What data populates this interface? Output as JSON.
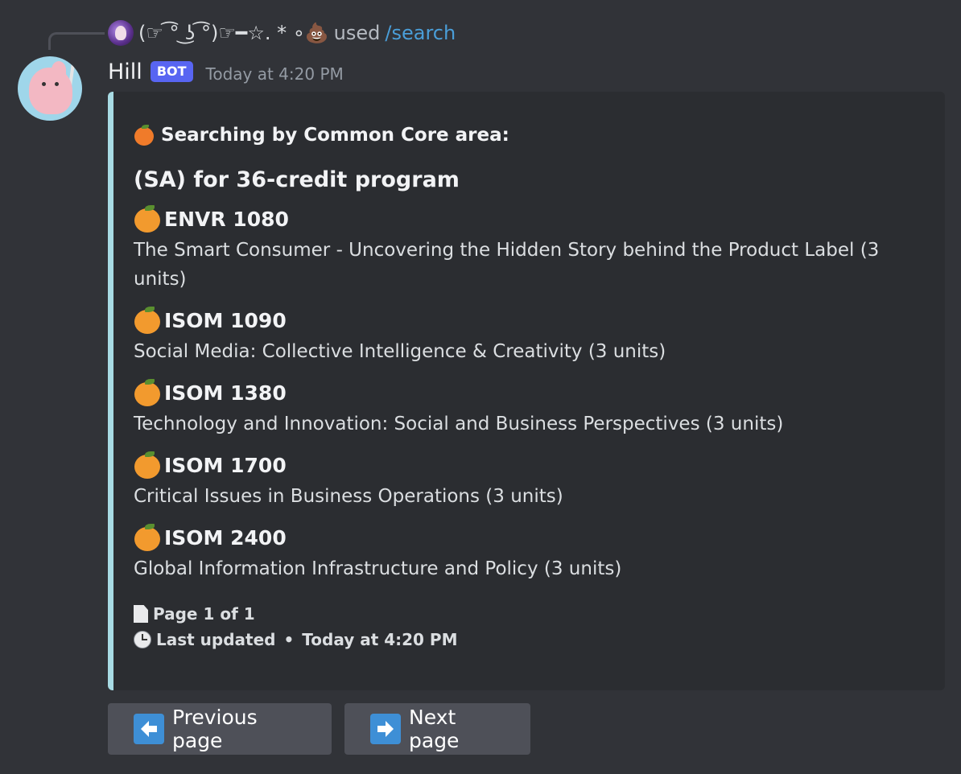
{
  "reply": {
    "user": "(☞ ͡° ͜ʖ ͡°)☞━☆. * ∘💩",
    "used_label": "used",
    "command": "/search"
  },
  "message": {
    "author": "Hill",
    "badge": "BOT",
    "timestamp": "Today at 4:20 PM"
  },
  "embed": {
    "author": "Searching by Common Core area:",
    "title": "(SA) for 36-credit program",
    "accent_color": "#a8dbe4",
    "courses": [
      {
        "code": "ENVR 1080",
        "description": "The Smart Consumer - Uncovering the Hidden Story behind the Product Label (3 units)"
      },
      {
        "code": "ISOM 1090",
        "description": "Social Media: Collective Intelligence & Creativity (3 units)"
      },
      {
        "code": "ISOM 1380",
        "description": "Technology and Innovation: Social and Business Perspectives (3 units)"
      },
      {
        "code": "ISOM 1700",
        "description": "Critical Issues in Business Operations (3 units)"
      },
      {
        "code": "ISOM 2400",
        "description": "Global Information Infrastructure and Policy (3 units)"
      }
    ],
    "footer": {
      "page": "Page 1 of 1",
      "updated_label": "Last updated",
      "updated_time": "Today at 4:20 PM"
    }
  },
  "buttons": {
    "previous": "Previous page",
    "next": "Next page"
  },
  "icons": {
    "course_icon": "tangerine-icon",
    "author_icon": "tangerine-icon",
    "page_icon": "page-icon",
    "clock_icon": "clock-icon",
    "prev_icon": "left-arrow-icon",
    "next_icon": "right-arrow-icon"
  },
  "colors": {
    "background": "#313338",
    "embed_bg": "#2b2d31",
    "bot_badge": "#5865f2",
    "command_link": "#4a9ed8",
    "button_bg": "#4e5058",
    "arrow_bg": "#3e8fd6"
  }
}
